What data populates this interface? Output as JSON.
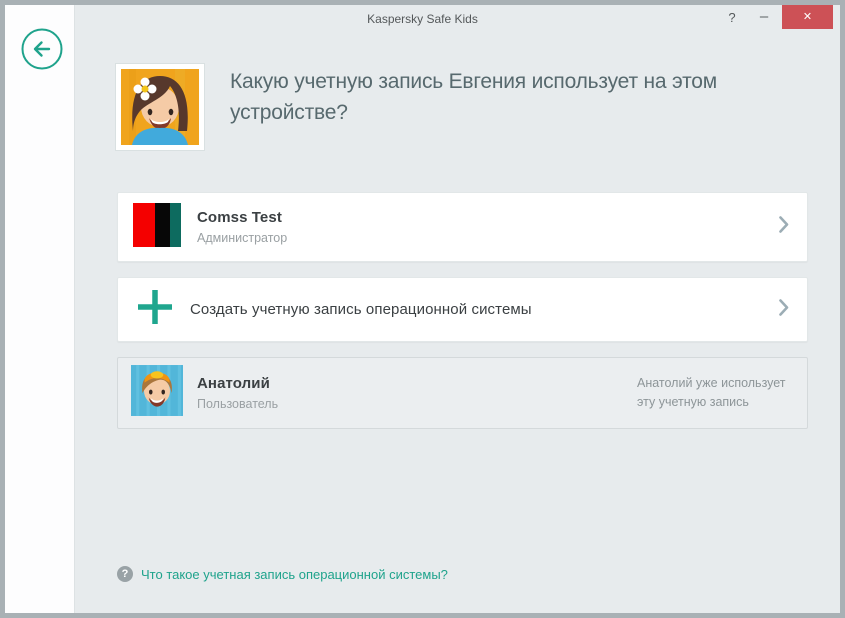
{
  "window": {
    "title": "Kaspersky Safe Kids",
    "controls": {
      "help": "?",
      "minimize": "–",
      "close": "✕"
    }
  },
  "header": {
    "question_line1": "Какую учетную запись Евгения использует на этом",
    "question_line2": "устройстве?",
    "child_avatar": "girl-avatar"
  },
  "accounts": {
    "admin": {
      "name": "Comss Test",
      "role": "Администратор",
      "icon": "flag-icon"
    },
    "create": {
      "label": "Создать учетную запись операционной системы",
      "icon": "plus-icon"
    },
    "user": {
      "name": "Анатолий",
      "role": "Пользователь",
      "icon": "boy-avatar",
      "status_line1": "Анатолий уже использует",
      "status_line2": "эту учетную запись"
    }
  },
  "footer": {
    "help_glyph": "?",
    "link": "Что такое учетная запись операционной системы?"
  },
  "colors": {
    "accent_teal": "#1fa38c",
    "close_red": "#cd5156",
    "main_background": "#e7ebed",
    "sidebar_background": "#fdfdfe",
    "frame_border": "#a9b1b5",
    "heading_text": "#57696e",
    "flag_red": "#f40000",
    "flag_black": "#070707",
    "flag_teal": "#0d6b5f"
  }
}
